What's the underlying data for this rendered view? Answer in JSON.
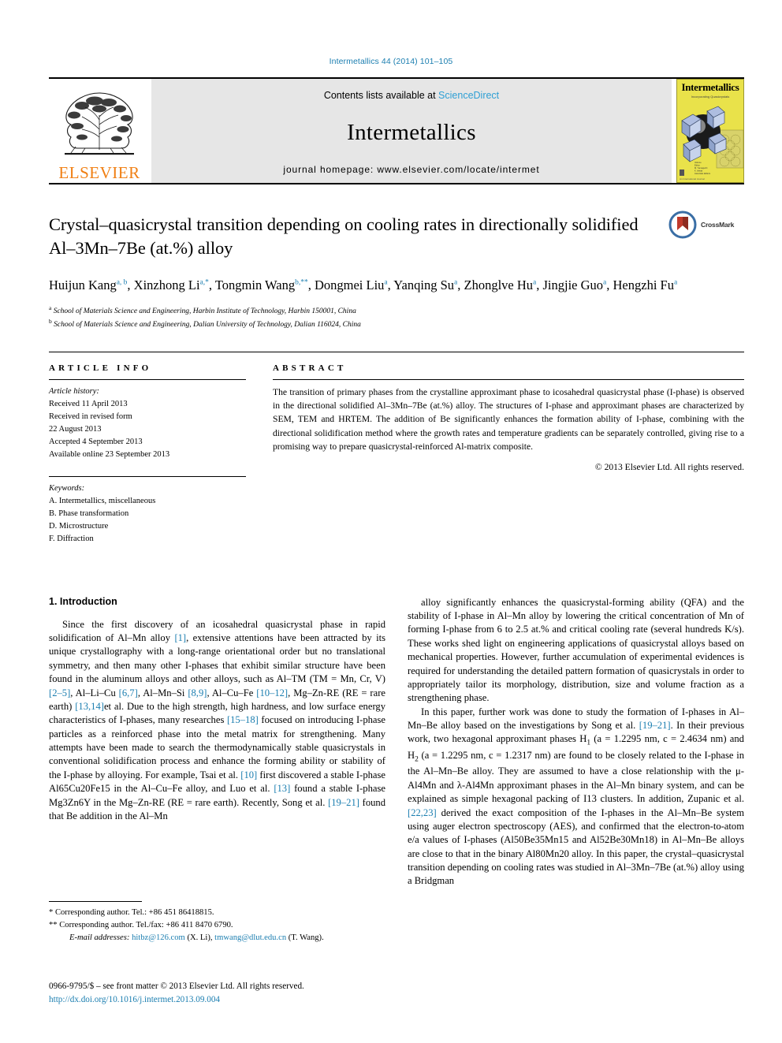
{
  "running_head": "Intermetallics 44 (2014) 101–105",
  "masthead": {
    "publisher_name": "ELSEVIER",
    "contents_prefix": "Contents lists available at ",
    "contents_link": "ScienceDirect",
    "journal_name": "Intermetallics",
    "homepage_label": "journal homepage: www.elsevier.com/locate/intermet",
    "cover": {
      "title": "Intermetallics",
      "subtitle": "Incorporating Quasicrystals",
      "footer": "An International Journal"
    }
  },
  "article": {
    "title": "Crystal–quasicrystal transition depending on cooling rates in directionally solidified Al–3Mn–7Be (at.%) alloy",
    "crossmark_label": "CrossMark",
    "authors": [
      {
        "name": "Huijun Kang",
        "marks": "a, b",
        "sep": ", "
      },
      {
        "name": "Xinzhong Li",
        "marks": "a,*",
        "sep": ", "
      },
      {
        "name": "Tongmin Wang",
        "marks": "b,**",
        "sep": ", "
      },
      {
        "name": "Dongmei Liu",
        "marks": "a",
        "sep": ", "
      },
      {
        "name": "Yanqing Su",
        "marks": "a",
        "sep": ", "
      },
      {
        "name": "Zhonglve Hu",
        "marks": "a",
        "sep": ", "
      },
      {
        "name": "Jingjie Guo",
        "marks": "a",
        "sep": ", "
      },
      {
        "name": "Hengzhi Fu",
        "marks": "a",
        "sep": ""
      }
    ],
    "affiliations": [
      {
        "mark": "a",
        "text": "School of Materials Science and Engineering, Harbin Institute of Technology, Harbin 150001, China"
      },
      {
        "mark": "b",
        "text": "School of Materials Science and Engineering, Dalian University of Technology, Dalian 116024, China"
      }
    ]
  },
  "article_info": {
    "heading": "ARTICLE INFO",
    "history_label": "Article history:",
    "history": [
      "Received 11 April 2013",
      "Received in revised form",
      "22 August 2013",
      "Accepted 4 September 2013",
      "Available online 23 September 2013"
    ],
    "keywords_label": "Keywords:",
    "keywords": [
      "A. Intermetallics, miscellaneous",
      "B. Phase transformation",
      "D. Microstructure",
      "F. Diffraction"
    ]
  },
  "abstract": {
    "heading": "ABSTRACT",
    "text": "The transition of primary phases from the crystalline approximant phase to icosahedral quasicrystal phase (I-phase) is observed in the directional solidified Al–3Mn–7Be (at.%) alloy. The structures of I-phase and approximant phases are characterized by SEM, TEM and HRTEM. The addition of Be significantly enhances the formation ability of I-phase, combining with the directional solidification method where the growth rates and temperature gradients can be separately controlled, giving rise to a promising way to prepare quasicrystal-reinforced Al-matrix composite.",
    "copyright": "© 2013 Elsevier Ltd. All rights reserved."
  },
  "body": {
    "section_heading": "1. Introduction",
    "left_paragraph_1_parts": [
      {
        "t": "Since the first discovery of an icosahedral quasicrystal phase in rapid solidification of Al–Mn alloy "
      },
      {
        "t": "[1]",
        "ref": true
      },
      {
        "t": ", extensive attentions have been attracted by its unique crystallography with a long-range orientational order but no translational symmetry, and then many other I-phases that exhibit similar structure have been found in the aluminum alloys and other alloys, such as Al–TM (TM = Mn, Cr, V) "
      },
      {
        "t": "[2–5]",
        "ref": true
      },
      {
        "t": ", Al–Li–Cu "
      },
      {
        "t": "[6,7]",
        "ref": true
      },
      {
        "t": ", Al–Mn–Si "
      },
      {
        "t": "[8,9]",
        "ref": true
      },
      {
        "t": ", Al–Cu–Fe "
      },
      {
        "t": "[10–12]",
        "ref": true
      },
      {
        "t": ", Mg–Zn-RE (RE = rare earth) "
      },
      {
        "t": "[13,14]",
        "ref": true
      },
      {
        "t": "et al. Due to the high strength, high hardness, and low surface energy characteristics of I-phases, many researches "
      },
      {
        "t": "[15–18]",
        "ref": true
      },
      {
        "t": " focused on introducing I-phase particles as a reinforced phase into the metal matrix for strengthening. Many attempts have been made to search the thermodynamically stable quasicrystals in conventional solidification process and enhance the forming ability or stability of the I-phase by alloying. For example, Tsai et al. "
      },
      {
        "t": "[10]",
        "ref": true
      },
      {
        "t": " first discovered a stable I-phase Al65Cu20Fe15 in the Al–Cu–Fe alloy, and Luo et al. "
      },
      {
        "t": "[13]",
        "ref": true
      },
      {
        "t": " found a stable I-phase Mg3Zn6Y in the Mg–Zn-RE (RE = rare earth). Recently, Song et al. "
      },
      {
        "t": "[19–21]",
        "ref": true
      },
      {
        "t": " found that Be addition in the Al–Mn"
      }
    ],
    "right_paragraph_1": "alloy significantly enhances the quasicrystal-forming ability (QFA) and the stability of I-phase in Al–Mn alloy by lowering the critical concentration of Mn of forming I-phase from 6 to 2.5 at.% and critical cooling rate (several hundreds K/s). These works shed light on engineering applications of quasicrystal alloys based on mechanical properties. However, further accumulation of experimental evidences is required for understanding the detailed pattern formation of quasicrystals in order to appropriately tailor its morphology, distribution, size and volume fraction as a strengthening phase.",
    "right_paragraph_2_parts": [
      {
        "t": "In this paper, further work was done to study the formation of I-phases in Al–Mn–Be alloy based on the investigations by Song et al. "
      },
      {
        "t": "[19–21]",
        "ref": true
      },
      {
        "t": ". In their previous work, two hexagonal approximant phases H1 (a = 1.2295 nm, c = 2.4634 nm) and H2 (a = 1.2295 nm, c = 1.2317 nm) are found to be closely related to the I-phase in the Al–Mn–Be alloy. They are assumed to have a close relationship with the μ-Al4Mn and λ-Al4Mn approximant phases in the Al–Mn binary system, and can be explained as simple hexagonal packing of I13 clusters. In addition, Zupanic et al. "
      },
      {
        "t": "[22,23]",
        "ref": true
      },
      {
        "t": " derived the exact composition of the I-phases in the Al–Mn–Be system using auger electron spectroscopy (AES), and confirmed that the electron-to-atom e/a values of I-phases (Al50Be35Mn15 and Al52Be30Mn18) in Al–Mn–Be alloys are close to that in the binary Al80Mn20 alloy. In this paper, the crystal–quasicrystal transition depending on cooling rates was studied in Al–3Mn–7Be (at.%) alloy using a Bridgman"
      }
    ]
  },
  "footnotes": {
    "corresponding_1": "* Corresponding author. Tel.: +86 451 86418815.",
    "corresponding_2": "** Corresponding author. Tel./fax: +86 411 8470 6790.",
    "email_label": "E-mail addresses:",
    "email_1": "hitbz@126.com",
    "email_1_owner": "(X. Li)",
    "email_2": "tmwang@dlut.edu.cn",
    "email_2_owner": "(T. Wang)."
  },
  "colophon": {
    "frontmatter": "0966-9795/$ – see front matter © 2013 Elsevier Ltd. All rights reserved.",
    "doi": "http://dx.doi.org/10.1016/j.intermet.2013.09.004"
  },
  "colors": {
    "link": "#1b7eb0",
    "sciencedirect": "#2e9fd4",
    "elsevier_orange": "#f07f13",
    "band_gray": "#e6e6e6",
    "cover_yellow": "#e9e24a"
  }
}
